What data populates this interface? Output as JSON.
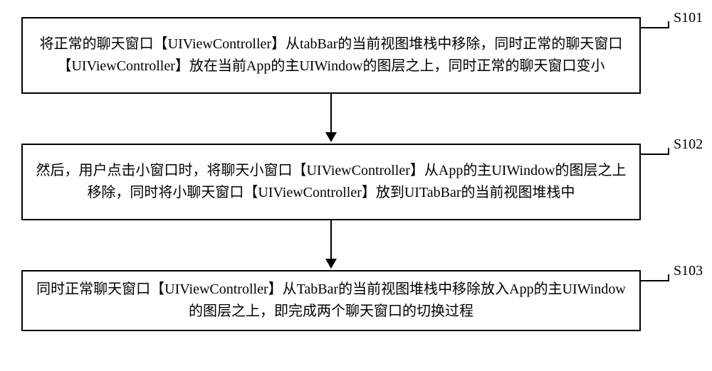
{
  "steps": [
    {
      "id": "S101",
      "text": "将正常的聊天窗口【UIViewController】从tabBar的当前视图堆栈中移除，同时正常的聊天窗口【UIViewController】放在当前App的主UIWindow的图层之上，同时正常的聊天窗口变小"
    },
    {
      "id": "S102",
      "text": "然后，用户点击小窗口时，将聊天小窗口【UIViewController】从App的主UIWindow的图层之上移除，同时将小聊天窗口【UIViewController】放到UITabBar的当前视图堆栈中"
    },
    {
      "id": "S103",
      "text": "同时正常聊天窗口【UIViewController】从TabBar的当前视图堆栈中移除放入App的主UIWindow的图层之上，即完成两个聊天窗口的切换过程"
    }
  ]
}
